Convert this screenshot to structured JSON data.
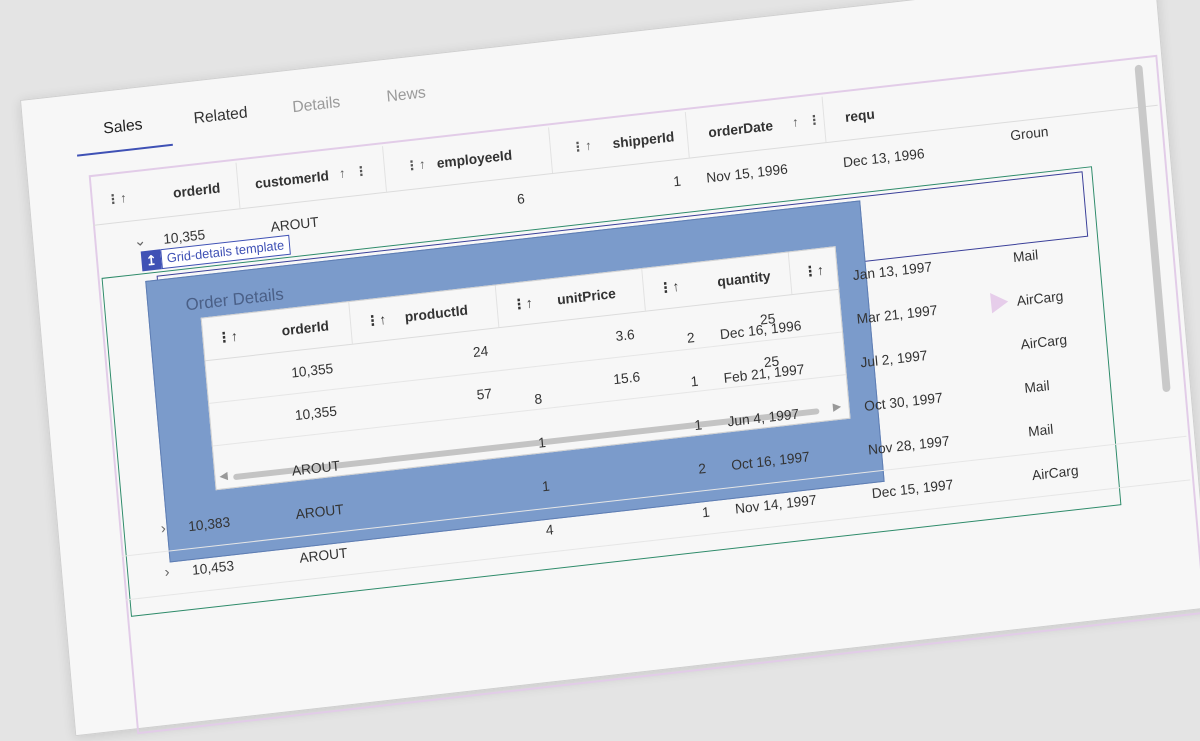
{
  "tabs": [
    {
      "label": "Sales",
      "active": true
    },
    {
      "label": "Related",
      "active": false
    },
    {
      "label": "Details",
      "active": false
    },
    {
      "label": "News",
      "active": false
    }
  ],
  "grid": {
    "columns": [
      "orderId",
      "customerId",
      "employeeId",
      "shipperId",
      "orderDate",
      "requ",
      "Groun"
    ],
    "sort_icon": "↑",
    "menu_icon": "⋮",
    "expanded_row": {
      "orderId": "10,355",
      "customerId": "AROUT",
      "employeeId": "6",
      "shipperId": "1",
      "orderDate": "Nov 15, 1996",
      "requiredDate": "Dec 13, 1996"
    },
    "rows": [
      {
        "orderId": "",
        "customerId": "",
        "employeeId": "",
        "shipperId": "",
        "orderDate": "",
        "requiredDate": "Jan 13, 1997",
        "ship": "Mail"
      },
      {
        "orderId": "",
        "customerId": "",
        "employeeId": "",
        "shipperId": "2",
        "orderDate": "Dec 16, 1996",
        "requiredDate": "Mar 21, 1997",
        "ship": "AirCarg"
      },
      {
        "orderId": "",
        "customerId": "",
        "employeeId": "8",
        "shipperId": "1",
        "orderDate": "Feb 21, 1997",
        "requiredDate": "Jul 2, 1997",
        "ship": "AirCarg"
      },
      {
        "orderId": "",
        "customerId": "AROUT",
        "employeeId": "1",
        "shipperId": "1",
        "orderDate": "Jun 4, 1997",
        "requiredDate": "Oct 30, 1997",
        "ship": "Mail"
      },
      {
        "orderId": "10,383",
        "customerId": "AROUT",
        "employeeId": "1",
        "shipperId": "2",
        "orderDate": "Oct 16, 1997",
        "requiredDate": "Nov 28, 1997",
        "ship": "Mail"
      },
      {
        "orderId": "10,453",
        "customerId": "AROUT",
        "employeeId": "4",
        "shipperId": "1",
        "orderDate": "Nov 14, 1997",
        "requiredDate": "Dec 15, 1997",
        "ship": "AirCarg"
      }
    ]
  },
  "template_label": "Grid-details template",
  "template_badge": "↥",
  "detail": {
    "title": "Order Details",
    "columns": [
      "orderId",
      "productId",
      "unitPrice",
      "quantity"
    ],
    "rows": [
      {
        "orderId": "10,355",
        "productId": "24",
        "unitPrice": "3.6",
        "quantity": "25"
      },
      {
        "orderId": "10,355",
        "productId": "57",
        "unitPrice": "15.6",
        "quantity": "25"
      }
    ]
  },
  "colors": {
    "accent": "#3f51b5",
    "detail_bg": "#7b9bcb",
    "green_frame": "#2e8b6a",
    "pink_frame": "#e2cce8"
  }
}
